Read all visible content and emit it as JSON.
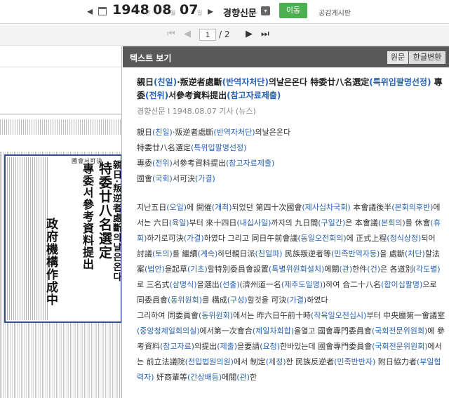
{
  "topbar": {
    "prev_icon": "◂",
    "next_icon": "▸",
    "year": "1948",
    "year_unit": "년",
    "month": "08",
    "month_unit": "월",
    "day": "07",
    "day_unit": "일",
    "paper": "경향신문",
    "paper_drop": "▾",
    "go_label": "이동",
    "board_label": "공감게시판"
  },
  "pager": {
    "current": "1",
    "total": "/ 2"
  },
  "scan": {
    "heading_big": "特委廿八名選定",
    "heading_mid": "專委서參考資料提出",
    "heading_small": "親日·叛逆者處斷의날은온다",
    "heading_lower": "政府機構作成中",
    "box_label": "國會서可決"
  },
  "panel": {
    "title": "텍스트 보기",
    "toggle_original": "원문",
    "toggle_korean": "한글변환"
  },
  "article": {
    "title_html": "親日<span class='hl'>(친일)</span>·叛逆者處斷<span class='hl'>(반역자처단)</span>의날은온다 特委廿八名選定<span class='hl'>(특위입팔명선정)</span> 專委<span class='hl'>(전위)</span>서參考資料提出<span class='hl'>(참고자료제출)</span>",
    "byline": "경향신문 I 1948.08.07 기사 (뉴스)",
    "headlines": [
      "親日<span class='hl'>(친일)</span>·叛逆者處斷<span class='hl'>(반역자처단)</span>의날은온다",
      "特委廿八名選定<span class='hl'>(특위입팔명선정)</span>",
      "專委<span class='hl'>(전위)</span>서參考資料提出<span class='hl'>(참고자료제출)</span>",
      "國會<span class='hl'>(국회)</span>서可決<span class='hl'>(가결)</span>"
    ],
    "paragraphs": [
      "지난五日<span class='hl'>(오일)</span>에 開催<span class='hl'>(개최)</span>되었던 第四十次國會<span class='hl'>(제사십차국회)</span> 本會議後半<span class='hl'>(본회의후반)</span>에서는 六日<span class='hl'>(육일)</span>부터 來十四日<span class='hl'>(내십사일)</span>까지의 九日間<span class='hl'>(구일간)</span>은 本會議<span class='hl'>(본회의)</span>를 休會<span class='hl'>(휴회)</span>하기로可決<span class='hl'>(가결)</span>하였다 그리고 同日午前會議<span class='hl'>(동일오전회의)</span>에 正式上程<span class='hl'>(정식상정)</span>되어 討議<span class='hl'>(토의)</span>를 繼續<span class='hl'>(계속)</span>하던親日派<span class='hl'>(친일파)</span> 民族叛逆者等<span class='hl'>(민족반역자등)</span>을 處斷<span class='hl'>(처단)</span>할法案<span class='hl'>(법안)</span>을起草<span class='hl'>(기초)</span>할特別委員會設置<span class='hl'>(특별위원회설치)</span>에關<span class='hl'>(관)</span>한件<span class='hl'>(건)</span>은 各道別<span class='hl'>(각도별)</span>로 三名式<span class='hl'>(삼명식)</span>을選出<span class='hl'>(선출)</span>(濟州道一名<span class='hl'>(제주도일명)</span>)하여 合二十八名<span class='hl'>(합이십팔명)</span>으로 同委員會<span class='hl'>(동위원회)</span>를 構成<span class='hl'>(구성)</span>할것을 可決<span class='hl'>(가결)</span>하였다",
      "그리하여 同委員會<span class='hl'>(동위원회)</span>에서는 昨六日午前十時<span class='hl'>(작육일오전십시)</span>부터 中央廳第一會議室<span class='hl'>(중앙청제일회의실)</span>에서第一次會合<span class='hl'>(제일차회합)</span>을열고 國會專門委員會<span class='hl'>(국회전문위원회)</span>에 參考資料<span class='hl'>(참고자료)</span>의提出<span class='hl'>(제출)</span>을要請<span class='hl'>(요청)</span>한바있는데 國會專門委員會<span class='hl'>(국회전문위원회)</span>에서는 前立法議院<span class='hl'>(전입법원의원)</span>에서 制定<span class='hl'>(제정)</span>한 民族反逆者<span class='hl'>(민족반반자)</span> 附日協力者<span class='hl'>(부일협력자)</span> 奸商輩等<span class='hl'>(간상배등)</span>에關<span class='hl'>(관)</span>한"
    ]
  }
}
